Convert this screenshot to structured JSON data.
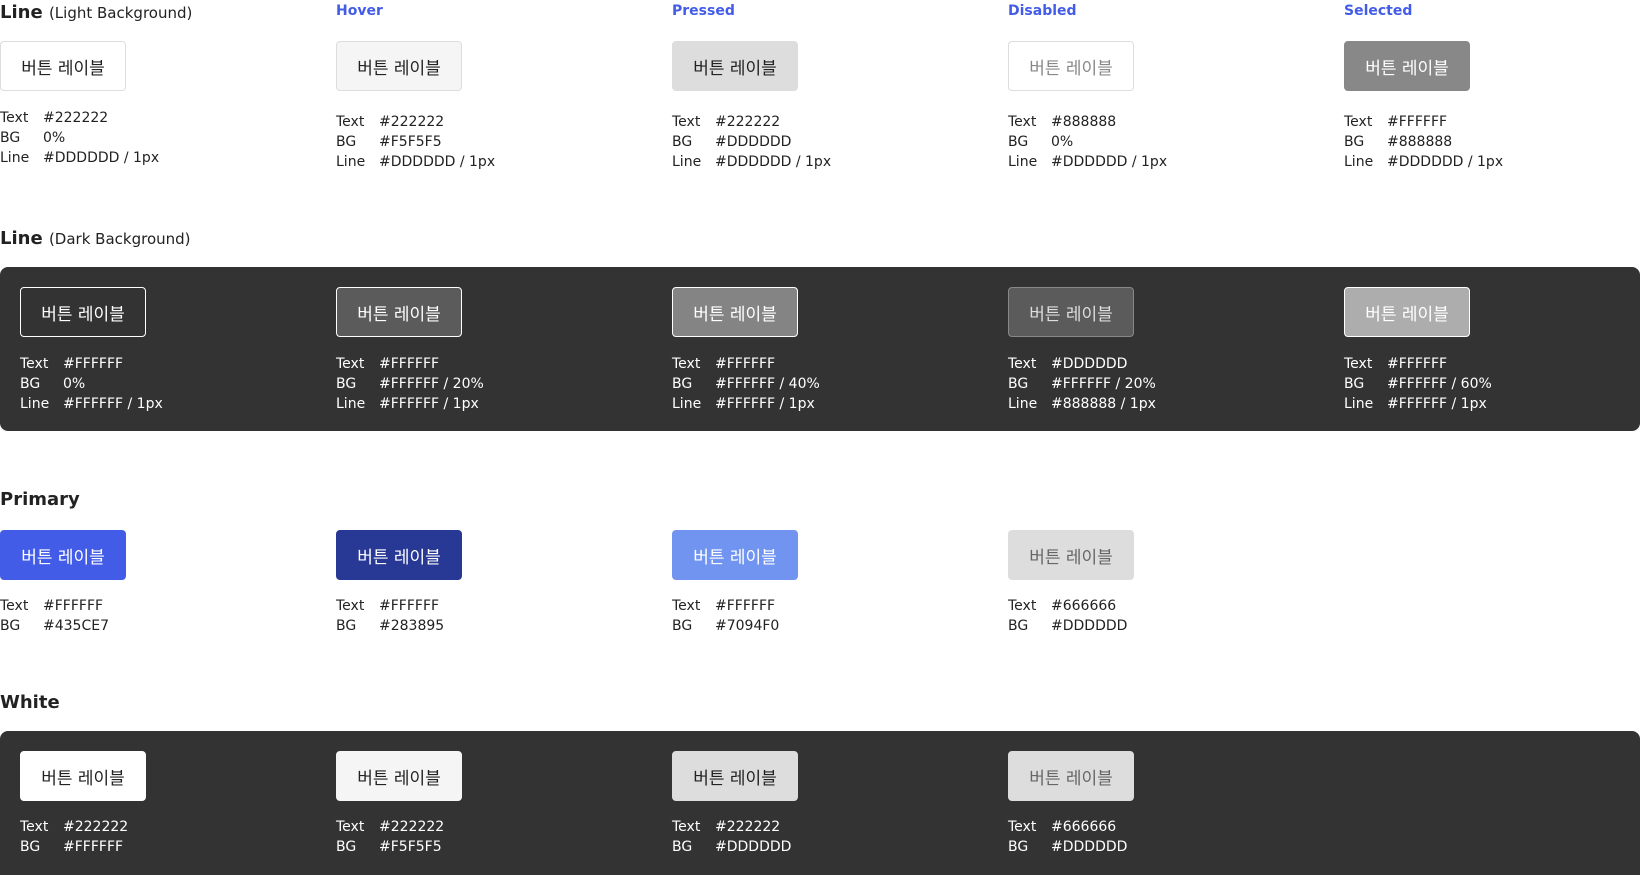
{
  "button_label": "버튼 레이블",
  "states": {
    "hover": "Hover",
    "pressed": "Pressed",
    "disabled": "Disabled",
    "selected": "Selected"
  },
  "keys": {
    "text": "Text",
    "bg": "BG",
    "line": "Line"
  },
  "line_light": {
    "title": "Line",
    "subtitle": "(Light Background)",
    "variants": [
      {
        "text": "#222222",
        "bg": "0%",
        "line": "#DDDDDD / 1px"
      },
      {
        "text": "#222222",
        "bg": "#F5F5F5",
        "line": "#DDDDDD / 1px"
      },
      {
        "text": "#222222",
        "bg": "#DDDDDD",
        "line": "#DDDDDD / 1px"
      },
      {
        "text": "#888888",
        "bg": "0%",
        "line": "#DDDDDD / 1px"
      },
      {
        "text": "#FFFFFF",
        "bg": "#888888",
        "line": "#DDDDDD / 1px"
      }
    ]
  },
  "line_dark": {
    "title": "Line",
    "subtitle": "(Dark Background)",
    "panel_color": "#333333",
    "variants": [
      {
        "text": "#FFFFFF",
        "bg": "0%",
        "line": "#FFFFFF / 1px"
      },
      {
        "text": "#FFFFFF",
        "bg": "#FFFFFF / 20%",
        "line": "#FFFFFF / 1px"
      },
      {
        "text": "#FFFFFF",
        "bg": "#FFFFFF / 40%",
        "line": "#FFFFFF / 1px"
      },
      {
        "text": "#DDDDDD",
        "bg": "#FFFFFF / 20%",
        "line": "#888888 / 1px"
      },
      {
        "text": "#FFFFFF",
        "bg": "#FFFFFF / 60%",
        "line": "#FFFFFF / 1px"
      }
    ]
  },
  "primary": {
    "title": "Primary",
    "variants": [
      {
        "text": "#FFFFFF",
        "bg": "#435CE7"
      },
      {
        "text": "#FFFFFF",
        "bg": "#283895"
      },
      {
        "text": "#FFFFFF",
        "bg": "#7094F0"
      },
      {
        "text": "#666666",
        "bg": "#DDDDDD"
      }
    ]
  },
  "white": {
    "title": "White",
    "panel_color": "#333333",
    "variants": [
      {
        "text": "#222222",
        "bg": "#FFFFFF"
      },
      {
        "text": "#222222",
        "bg": "#F5F5F5"
      },
      {
        "text": "#222222",
        "bg": "#DDDDDD"
      },
      {
        "text": "#666666",
        "bg": "#DDDDDD"
      }
    ]
  }
}
